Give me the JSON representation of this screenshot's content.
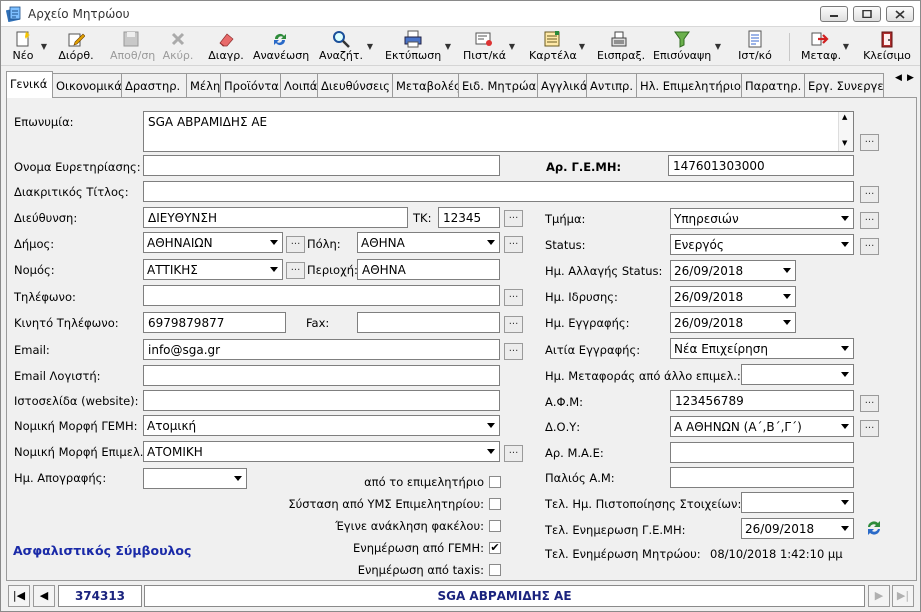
{
  "window": {
    "title": "Αρχείο Μητρώου"
  },
  "toolbar": [
    {
      "name": "new",
      "label": "Νέο",
      "icon": "new-icon",
      "dis": false,
      "drop": true
    },
    {
      "name": "edit",
      "label": "Διόρθ.",
      "icon": "edit-pencil-icon",
      "dis": false,
      "drop": false
    },
    {
      "name": "save",
      "label": "Αποθ/ση",
      "icon": "save-disk-icon",
      "dis": true,
      "drop": false
    },
    {
      "name": "cancel",
      "label": "Ακύρ.",
      "icon": "cancel-x-icon",
      "dis": true,
      "drop": false
    },
    {
      "name": "delete",
      "label": "Διαγρ.",
      "icon": "eraser-icon",
      "dis": false,
      "drop": false
    },
    {
      "name": "refresh",
      "label": "Ανανέωση",
      "icon": "refresh-icon",
      "dis": false,
      "drop": false
    },
    {
      "name": "search",
      "label": "Αναζήτ.",
      "icon": "magnifier-icon",
      "dis": false,
      "drop": true
    },
    {
      "name": "print",
      "label": "Εκτύπωση",
      "icon": "printer-icon",
      "dis": false,
      "drop": true
    },
    {
      "name": "certificate",
      "label": "Πιστ/κά",
      "icon": "certificate-icon",
      "dis": false,
      "drop": true
    },
    {
      "name": "card",
      "label": "Καρτέλα",
      "icon": "ledger-card-icon",
      "dis": false,
      "drop": true
    },
    {
      "name": "collection",
      "label": "Εισπραξ.",
      "icon": "cash-register-icon",
      "dis": false,
      "drop": false
    },
    {
      "name": "merge",
      "label": "Επισύναψη",
      "icon": "funnel-attach-icon",
      "dis": false,
      "drop": true
    },
    {
      "name": "history",
      "label": "Ιστ/κό",
      "icon": "history-doc-icon",
      "dis": false,
      "drop": false
    },
    {
      "name": "transfer",
      "label": "Μεταφ.",
      "icon": "transfer-arrow-icon",
      "dis": false,
      "drop": true
    },
    {
      "name": "close",
      "label": "Κλείσιμο",
      "icon": "exit-door-icon",
      "dis": false,
      "drop": false
    }
  ],
  "tabs": [
    "Γενικά",
    "Οικονομικά",
    "Δραστηρ.",
    "Μέλη",
    "Προϊόντα",
    "Λοιπά",
    "Διευθύνσεις",
    "Μεταβολές",
    "Ειδ. Μητρώα",
    "Αγγλικά",
    "Αντιπρ.",
    "Ηλ. Επιμελητήριο",
    "Παρατηρ.",
    "Εργ. Συνεργείο"
  ],
  "form": {
    "eponymia": {
      "label": "Επωνυμία:",
      "value": "SGA ΑΒΡΑΜΙΔΗΣ ΑΕ"
    },
    "onoma_eyretiriasis": {
      "label": "Ονομα Ευρετηρίασης:",
      "value": ""
    },
    "ar_gemi": {
      "label": "Αρ. Γ.Ε.ΜΗ:",
      "value": "147601303000"
    },
    "diakritikos": {
      "label": "Διακριτικός Τίτλος:",
      "value": ""
    },
    "dieythynsi": {
      "label": "Διεύθυνση:",
      "value": "ΔΙΕΥΘΥΝΣΗ"
    },
    "tk": {
      "label": "ΤΚ:",
      "value": "12345"
    },
    "tmima": {
      "label": "Τμήμα:",
      "value": "Υπηρεσιών"
    },
    "dimos": {
      "label": "Δήμος:",
      "value": "ΑΘΗΝΑΙΩΝ"
    },
    "poli": {
      "label": "Πόλη:",
      "value": "ΑΘΗΝΑ"
    },
    "status": {
      "label": "Status:",
      "value": "Ενεργός"
    },
    "nomos": {
      "label": "Νομός:",
      "value": "ΑΤΤΙΚΗΣ"
    },
    "perioxi": {
      "label": "Περιοχή:",
      "value": "ΑΘΗΝΑ"
    },
    "im_allagis_status": {
      "label": "Ημ. Αλλαγής Status:",
      "value": "26/09/2018"
    },
    "tilefono": {
      "label": "Τηλέφωνο:",
      "value": ""
    },
    "im_idrysis": {
      "label": "Ημ. Ιδρυσης:",
      "value": "26/09/2018"
    },
    "kinito": {
      "label": "Κινητό Τηλέφωνο:",
      "value": "6979879877"
    },
    "fax": {
      "label": "Fax:",
      "value": ""
    },
    "im_eggrafis": {
      "label": "Ημ. Εγγραφής:",
      "value": "26/09/2018"
    },
    "email": {
      "label": "Email:",
      "value": "info@sga.gr"
    },
    "aitia_eggrafis": {
      "label": "Αιτία Εγγραφής:",
      "value": "Νέα Επιχείρηση"
    },
    "email_logisti": {
      "label": "Email Λογιστή:",
      "value": ""
    },
    "im_metaforas": {
      "label": "Ημ. Μεταφοράς από άλλο επιμελ.:",
      "value": ""
    },
    "istoselida": {
      "label": "Ιστοσελίδα (website):",
      "value": ""
    },
    "afm": {
      "label": "Α.Φ.Μ:",
      "value": "123456789"
    },
    "nomiki_morfi_gemi": {
      "label": "Νομική Μορφή ΓΕΜΗ:",
      "value": "Ατομική"
    },
    "doy": {
      "label": "Δ.Ο.Υ:",
      "value": "Α ΑΘΗΝΩΝ (Α΄,Β΄,Γ΄)"
    },
    "nomiki_morfi_epimel": {
      "label": "Νομική Μορφή Επιμελ.:",
      "value": "ΑΤΟΜΙΚΗ"
    },
    "ar_mae": {
      "label": "Αρ. Μ.Α.Ε:",
      "value": ""
    },
    "im_apografis": {
      "label": "Ημ.  Απογραφής:",
      "value": ""
    },
    "palios_am": {
      "label": "Παλιός Α.Μ:",
      "value": ""
    },
    "tel_pistopoiisis": {
      "label": "Τελ. Ημ. Πιστοποίησης Στοιχείων:",
      "value": ""
    },
    "tel_enimerosi_gemi": {
      "label": "Τελ. Ενημερωση Γ.Ε.ΜΗ:",
      "value": "26/09/2018"
    },
    "tel_enimerosi_mitroou": {
      "label": "Τελ. Ενημέρωση Μητρώου:",
      "value": "08/10/2018 1:42:10 μμ"
    },
    "checks": [
      {
        "label": "από το επιμελητήριο",
        "checked": ""
      },
      {
        "label": "Σύσταση από ΥΜΣ Επιμελητηρίου:",
        "checked": ""
      },
      {
        "label": "Έγινε ανάκληση φακέλου:",
        "checked": ""
      },
      {
        "label": "Ενημέρωση από ΓΕΜΗ:",
        "checked": "✔"
      },
      {
        "label": "Ενημέρωση από taxis:",
        "checked": ""
      }
    ],
    "link": "Ασφαλιστικός Σύμβουλος"
  },
  "navigator": {
    "record_id": "374313",
    "record_name": "SGA ΑΒΡΑΜΙΔΗΣ ΑΕ"
  },
  "colors": {
    "link": "#1a2aa8",
    "accent": "#1a237e"
  }
}
